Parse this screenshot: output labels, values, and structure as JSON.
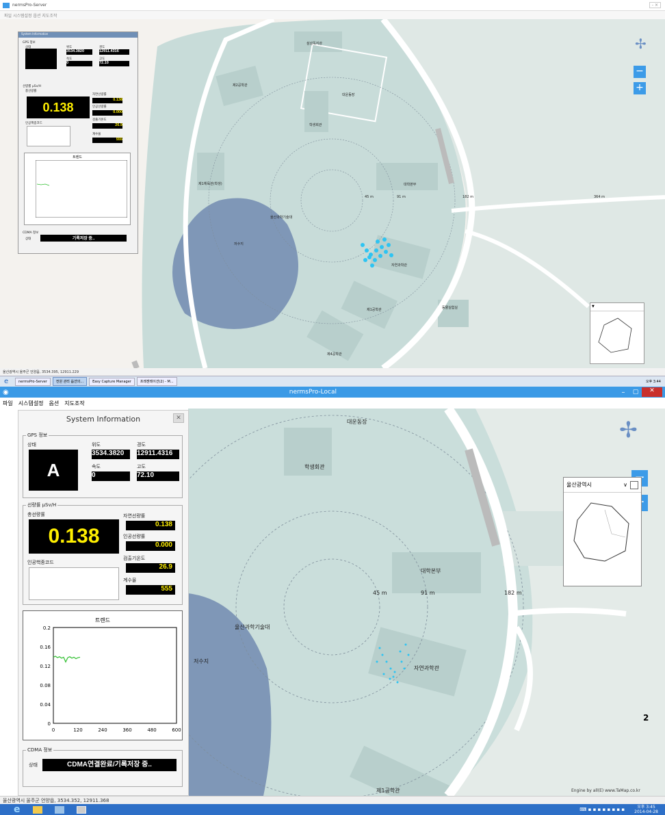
{
  "top": {
    "title": "nermsPro-Server",
    "menu": "파일 시스템설정 옵션 지도조작",
    "panel": {
      "title": "System Information",
      "gps": "GPS 정보",
      "status": "상태",
      "lat": "위도",
      "lat_val": "3534.3820",
      "lon": "경도",
      "lon_val": "12911.4316",
      "speed": "속도",
      "speed_val": "0",
      "alt": "고도",
      "alt_val": "72.10",
      "dose": "선량률 μSv/H",
      "total": "총선량률",
      "total_val": "0.138",
      "natural": "자연선량률",
      "natural_val": "0.138",
      "artificial": "인공선량률",
      "artificial_val": "0.000",
      "nuclide": "인공핵종코드",
      "temp": "검출기온도",
      "temp_val": "26.9",
      "count": "계수율",
      "count_val": "555",
      "trend": "트렌드",
      "cdma": "CDMA 정보",
      "cdma_status": "상태",
      "cdma_val": "기록저장 중.."
    },
    "map": {
      "labels": [
        "삼성독지관",
        "제2공학관",
        "제1체육관(학생)",
        "대운동장",
        "학생회관",
        "자연과학관",
        "대학본부",
        "울산과학기술대",
        "45 m",
        "91 m",
        "182 m",
        "364 m",
        "저수지",
        "자연과학관",
        "제1공학관",
        "동물실험실",
        "제4공학관"
      ]
    },
    "statusbar": "울산광역시 울주군 언양읍, 3534.395, 12911.229",
    "taskbar": {
      "items": [
        "nermsPro-Server",
        "전원 관리 옵션의...",
        "Easy Capture Manager",
        "프레젠테이션(2) - M..."
      ],
      "time": "오후 3:44"
    }
  },
  "bottom": {
    "title": "nermsPro-Local",
    "menu": [
      "파일",
      "시스템설정",
      "옵션",
      "지도조작"
    ],
    "panel": {
      "title": "System Information",
      "gps": "GPS 정보",
      "status": "상태",
      "status_val": "A",
      "lat": "위도",
      "lat_val": "3534.3820",
      "lon": "경도",
      "lon_val": "12911.4316",
      "speed": "속도",
      "speed_val": "0",
      "alt": "고도",
      "alt_val": "72.10",
      "dose": "선량률 μSv/H",
      "total": "총선량률",
      "total_val": "0.138",
      "natural": "자연선량률",
      "natural_val": "0.138",
      "artificial": "인공선량률",
      "artificial_val": "0.000",
      "nuclide": "인공핵종코드",
      "temp": "검출기온도",
      "temp_val": "26.9",
      "count": "계수율",
      "count_val": "555",
      "trend": "트렌드",
      "cdma": "CDMA 정보",
      "cdma_status": "상태",
      "cdma_val": "CDMA연결완료/기록저장 중.."
    },
    "map": {
      "labels": [
        "대운동장",
        "학생회관",
        "대학본부",
        "45 m",
        "91 m",
        "182 m",
        "울산과학기술대",
        "저수지",
        "자연과학관",
        "제1공학관"
      ],
      "region": "울산광역시",
      "attribution": "Engine by all(E) www.TaMap.co.kr",
      "scale": "2"
    },
    "statusbar": "울산광역시 울주군 언양읍, 3534.352, 12911.368",
    "taskbar": {
      "time": "오후 3:45",
      "date": "2014-04-28"
    }
  },
  "chart_data": {
    "type": "line",
    "title": "트렌드",
    "xlim": [
      0,
      600
    ],
    "ylim": [
      0,
      0.2
    ],
    "xticks": [
      "0",
      "120",
      "240",
      "360",
      "480",
      "600"
    ],
    "yticks": [
      "0",
      "0.04",
      "0.08",
      "0.12",
      "0.16",
      "0.2"
    ],
    "series": [
      {
        "x": [
          0,
          10,
          20,
          30,
          40,
          50,
          60,
          70,
          80,
          90,
          100,
          110,
          120,
          130
        ],
        "y": [
          0.138,
          0.14,
          0.137,
          0.139,
          0.136,
          0.138,
          0.128,
          0.137,
          0.139,
          0.136,
          0.138,
          0.135,
          0.137,
          0.138
        ]
      }
    ]
  },
  "colors": {
    "accent": "#3c9be8",
    "trend": "#2fbf2f",
    "water": "#7f97b7",
    "building": "#c5d9d7"
  }
}
